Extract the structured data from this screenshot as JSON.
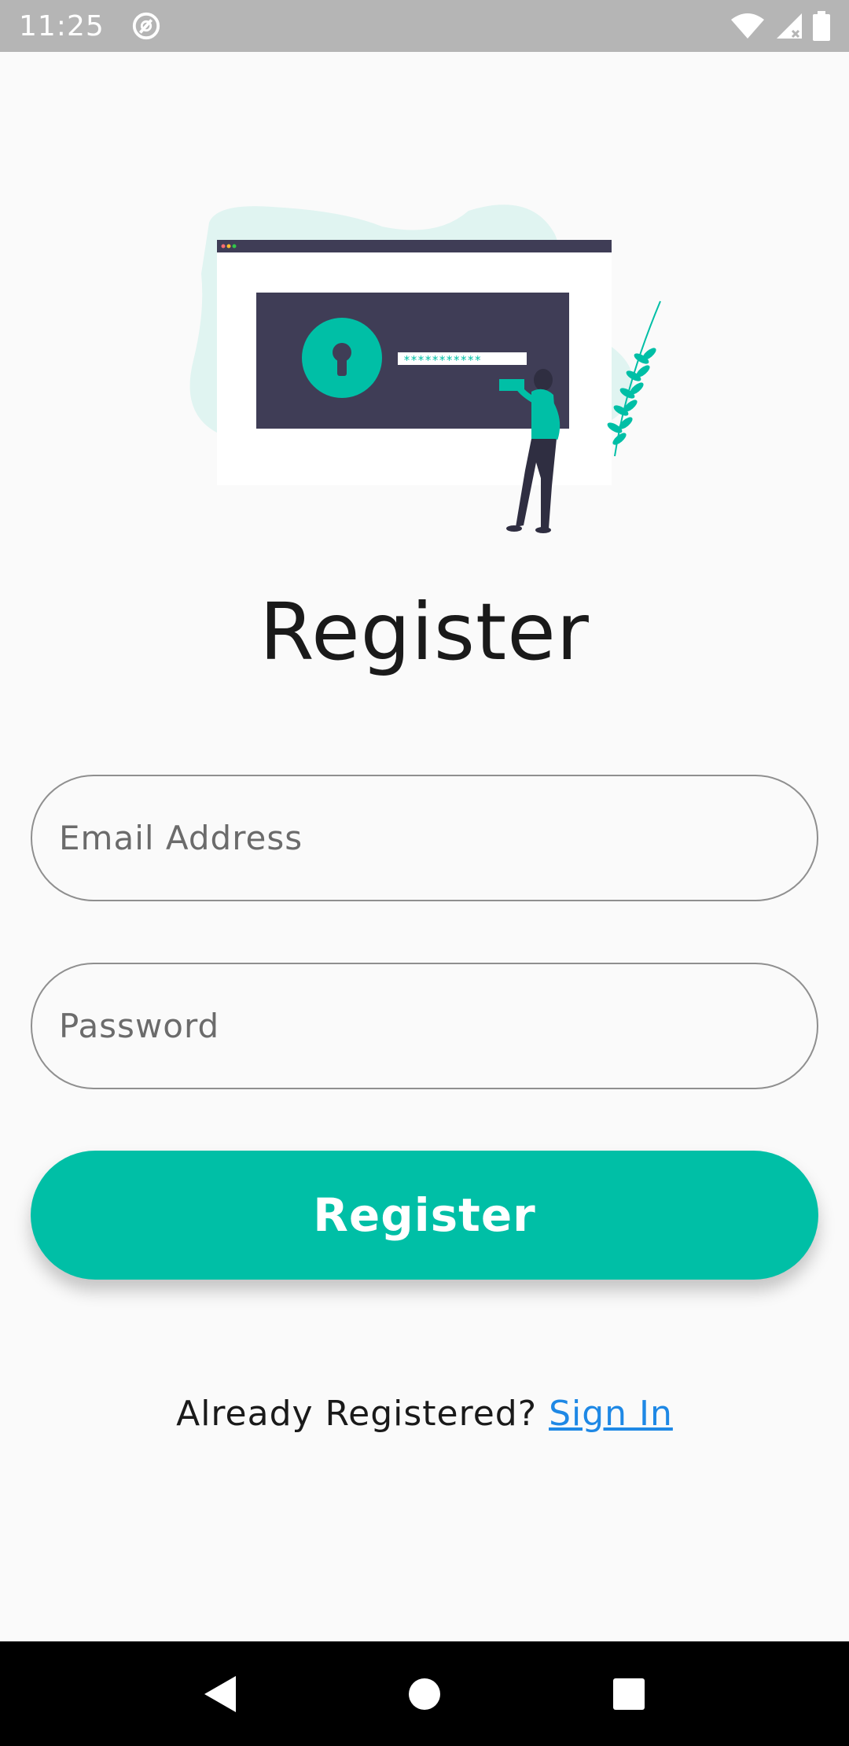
{
  "status_bar": {
    "time": "11:25",
    "icons": [
      "at-sign-icon",
      "wifi-icon",
      "signal-icon",
      "battery-icon"
    ]
  },
  "illustration": {
    "name": "secure-login-illustration",
    "password_mask": "***********",
    "colors": {
      "accent": "#00bfa6",
      "dark": "#3f3d56",
      "blob": "#e0f4f1"
    }
  },
  "title": "Register",
  "form": {
    "email_placeholder": "Email Address",
    "password_placeholder": "Password",
    "register_label": "Register"
  },
  "footer": {
    "prompt": "Already Registered? ",
    "link_label": "Sign In"
  },
  "nav_bar": {
    "icons": [
      "back-triangle-icon",
      "home-circle-icon",
      "recents-square-icon"
    ]
  },
  "colors": {
    "accent": "#00bfa6",
    "link": "#1e88e5",
    "status_bar": "#b5b5b5",
    "background": "#fafafa"
  }
}
